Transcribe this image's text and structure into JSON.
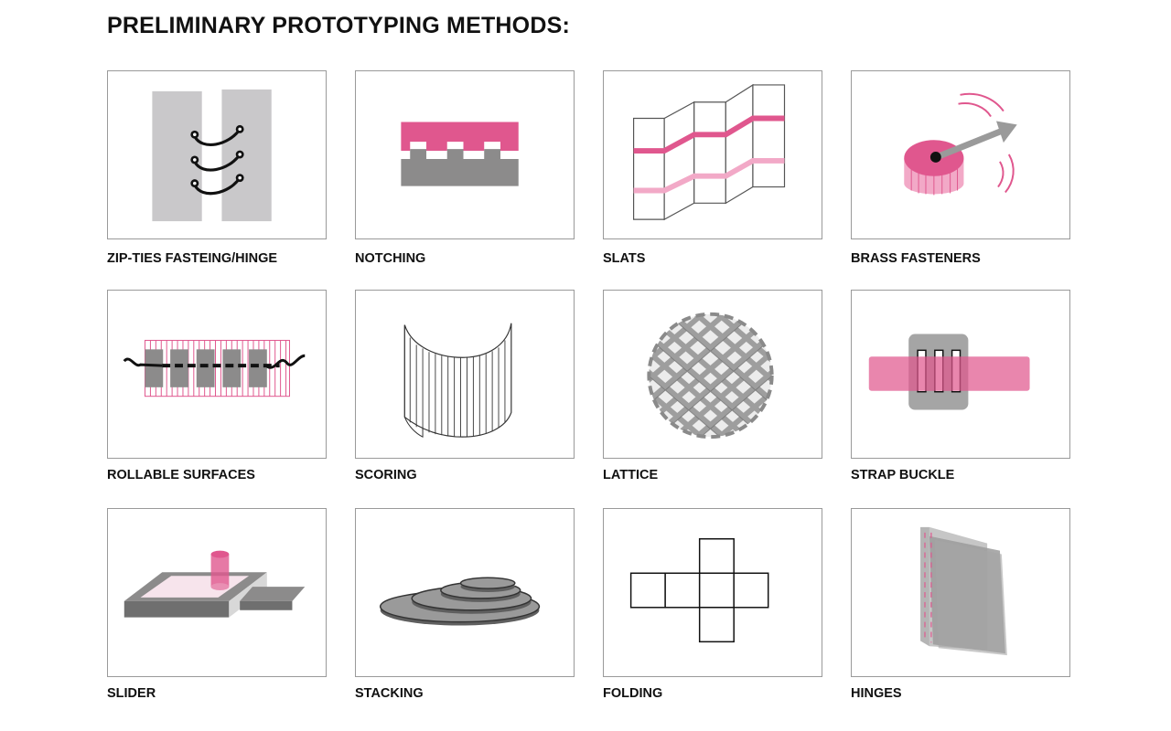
{
  "page": {
    "title": "PRELIMINARY PROTOTYPING METHODS:"
  },
  "colors": {
    "accent_pink": "#e0578e",
    "light_pink": "#f2a9c7",
    "gray": "#8c8c8c",
    "light_gray": "#c9c8ca",
    "dark_gray": "#555555"
  },
  "methods": [
    {
      "label": "ZIP-TIES FASTEING/HINGE",
      "icon": "zip-ties-hinge-illustration"
    },
    {
      "label": "NOTCHING",
      "icon": "notching-illustration"
    },
    {
      "label": "SLATS",
      "icon": "slats-illustration"
    },
    {
      "label": "BRASS FASTENERS",
      "icon": "brass-fastener-illustration"
    },
    {
      "label": "ROLLABLE SURFACES",
      "icon": "rollable-surface-illustration"
    },
    {
      "label": "SCORING",
      "icon": "scoring-illustration"
    },
    {
      "label": "LATTICE",
      "icon": "lattice-sphere-illustration"
    },
    {
      "label": "STRAP BUCKLE",
      "icon": "strap-buckle-illustration"
    },
    {
      "label": "SLIDER",
      "icon": "slider-illustration"
    },
    {
      "label": "STACKING",
      "icon": "stacking-illustration"
    },
    {
      "label": "FOLDING",
      "icon": "folding-net-illustration"
    },
    {
      "label": "HINGES",
      "icon": "hinges-illustration"
    }
  ]
}
